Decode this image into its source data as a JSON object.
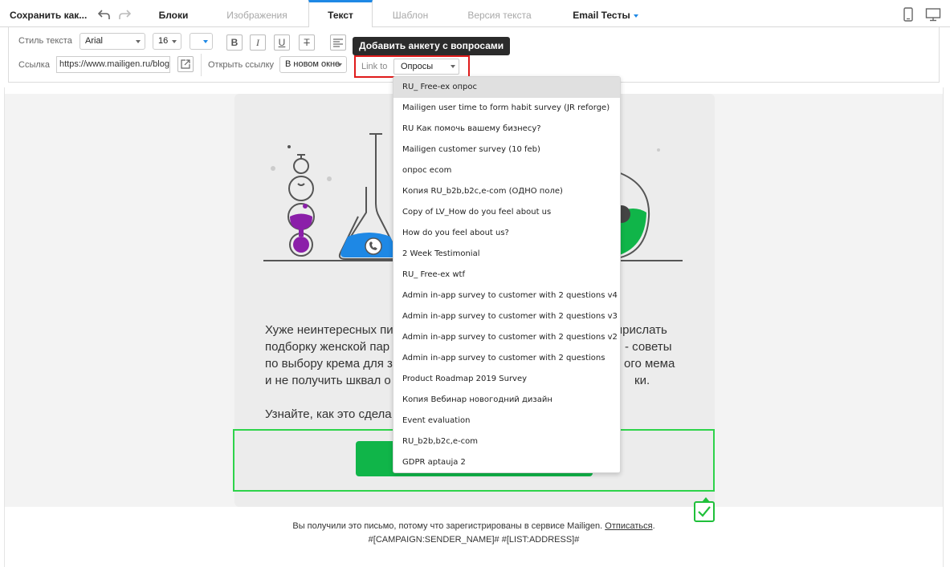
{
  "topbar": {
    "save_label": "Сохранить как...",
    "tabs": [
      {
        "label": "Блоки"
      },
      {
        "label": "Изображения"
      },
      {
        "label": "Текст"
      },
      {
        "label": "Шаблон"
      },
      {
        "label": "Версия текста"
      },
      {
        "label": "Email Тесты"
      }
    ]
  },
  "toolbar": {
    "style_label": "Стиль текста",
    "font_family": "Arial",
    "font_size": "16",
    "bold_glyph": "B",
    "italic_glyph": "I",
    "underline_glyph": "U",
    "strike_glyph": "T",
    "link_label": "Ссылка",
    "link_value": "https://www.mailigen.ru/blog",
    "open_link_label": "Открыть ссылку",
    "open_link_value": "В новом окне",
    "link_to_label": "Link to",
    "link_to_value": "Опросы"
  },
  "tooltip": "Добавить анкету с вопросами",
  "email": {
    "paragraph1_lines": [
      "Хуже неинтересных пи",
      "подборку женской пар",
      "по выбору крема для з",
      "и не получить шквал о"
    ],
    "paragraph1_right": [
      "прислать",
      "- советы",
      "ого мема",
      "ки."
    ],
    "paragraph2": "Узнайте, как это сдела",
    "footer_text": "Вы получили это письмо, потому что зарегистрированы в сервисе Mailigen.",
    "footer_link": "Отписаться",
    "footer_tokens": "#[CAMPAIGN:SENDER_NAME]#  #[LIST:ADDRESS]#"
  },
  "dropdown": {
    "items": [
      "RU_ Free-ex опрос",
      "Mailigen user time to form habit survey (JR reforge)",
      "RU Как помочь вашему бизнесу?",
      "Mailigen customer survey (10 feb)",
      "опрос ecom",
      "Копия RU_b2b,b2c,e-com (ОДНО поле)",
      "Copy of LV_How do you feel about us",
      "How do you feel about us?",
      "2 Week Testimonial",
      "RU_ Free-ex wtf",
      "Admin in-app survey to customer with 2 questions v4",
      "Admin in-app survey to customer with 2 questions v3",
      "Admin in-app survey to customer with 2 questions v2",
      "Admin in-app survey to customer with 2 questions",
      "Product Roadmap 2019 Survey",
      "Копия Вебинар новогодний дизайн",
      "Event evaluation",
      "RU_b2b,b2c,e-com",
      "GDPR aptauja 2"
    ]
  },
  "colors": {
    "accent_blue": "#1e88e5",
    "highlight_red": "#e01b1b",
    "cta_green": "#10b549",
    "selection_green": "#2ed34a",
    "purple": "#8b1fa9"
  }
}
